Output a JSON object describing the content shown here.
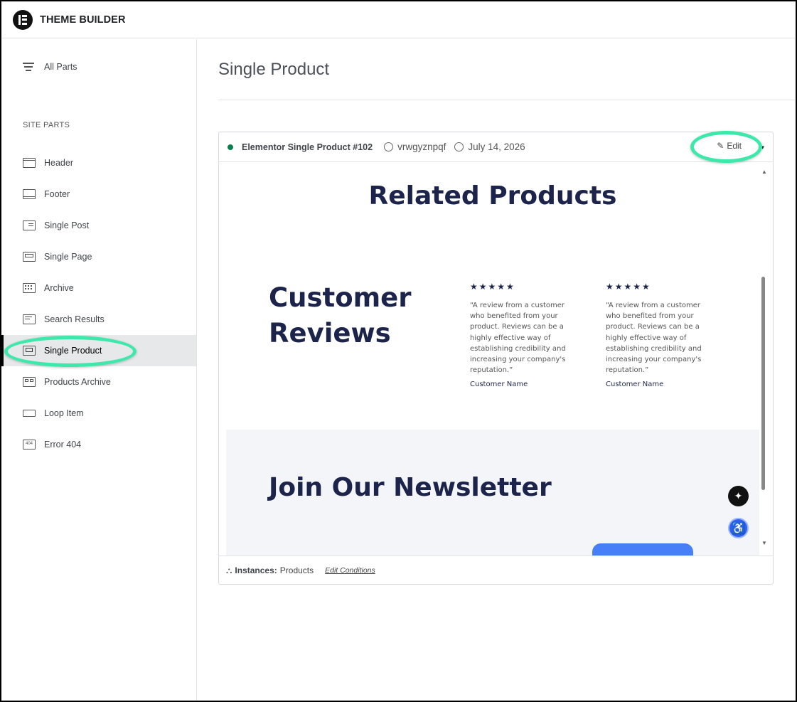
{
  "app": {
    "title": "THEME BUILDER"
  },
  "sidebar": {
    "all_parts": "All Parts",
    "section_label": "SITE PARTS",
    "items": [
      {
        "label": "Header",
        "icon": "header-icon"
      },
      {
        "label": "Footer",
        "icon": "footer-icon"
      },
      {
        "label": "Single Post",
        "icon": "single-post-icon"
      },
      {
        "label": "Single Page",
        "icon": "single-page-icon"
      },
      {
        "label": "Archive",
        "icon": "archive-icon"
      },
      {
        "label": "Search Results",
        "icon": "search-results-icon"
      },
      {
        "label": "Single Product",
        "icon": "single-product-icon",
        "active": true
      },
      {
        "label": "Products Archive",
        "icon": "products-archive-icon"
      },
      {
        "label": "Loop Item",
        "icon": "loop-item-icon"
      },
      {
        "label": "Error 404",
        "icon": "error-404-icon"
      }
    ]
  },
  "main": {
    "title": "Single Product",
    "card": {
      "status_color": "#0b7f4e",
      "doc_title": "Elementor Single Product #102",
      "author": "vrwgyznpqf",
      "date": "July 14, 2026",
      "edit_label": "Edit",
      "preview": {
        "related_title": "Related Products",
        "reviews_title_line1": "Customer",
        "reviews_title_line2": "Reviews",
        "reviews": [
          {
            "stars": "★★★★★",
            "quote": "“A review from a customer who benefited from your product. Reviews can be a highly effective way of establishing credibility and increasing your company's reputation.”",
            "name": "Customer Name"
          },
          {
            "stars": "★★★★★",
            "quote": "“A review from a customer who benefited from your product. Reviews can be a highly effective way of establishing credibility and increasing your company's reputation.”",
            "name": "Customer Name"
          }
        ],
        "newsletter_title": "Join Our Newsletter"
      },
      "instances_label": "Instances:",
      "instances_value": "Products",
      "edit_conditions": "Edit Conditions"
    }
  },
  "colors": {
    "highlight": "#3de8ab",
    "heading": "#1c244b",
    "button": "#467ff7"
  }
}
